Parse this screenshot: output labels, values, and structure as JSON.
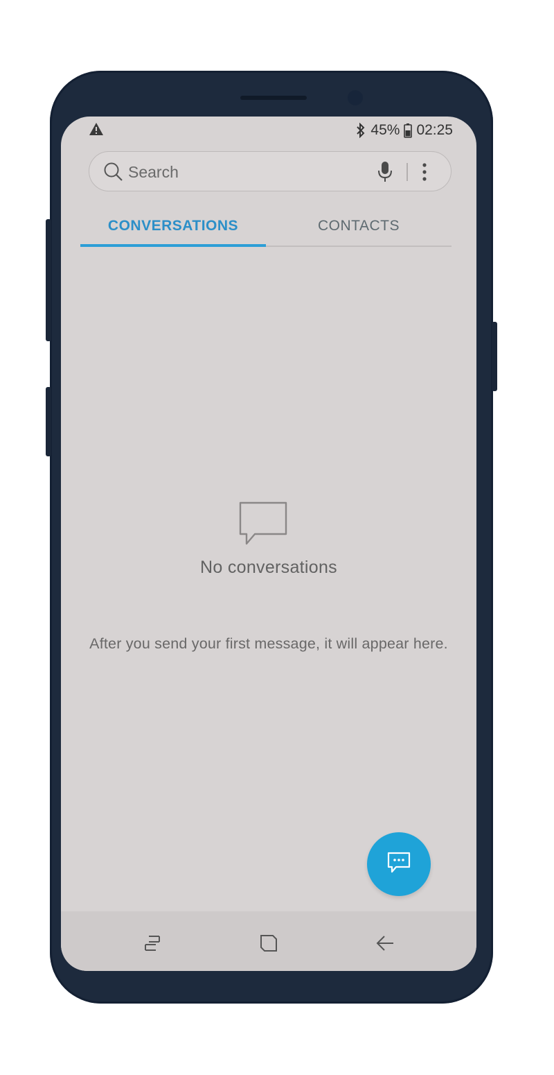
{
  "status_bar": {
    "battery": "45%",
    "time": "02:25"
  },
  "search": {
    "placeholder": "Search"
  },
  "tabs": [
    {
      "label": "CONVERSATIONS",
      "selected": true
    },
    {
      "label": "CONTACTS",
      "selected": false
    }
  ],
  "empty_state": {
    "title": "No conversations",
    "description": "After you send your first message, it will appear here."
  },
  "colors": {
    "accent": "#2c9ed6",
    "fab": "#1fa3d8",
    "screen_bg": "#d7d3d3",
    "phone_body": "#1d2a3d"
  },
  "icons": {
    "status_left": "warning-icon",
    "status_right": [
      "bluetooth-icon",
      "battery-icon"
    ],
    "search": [
      "search-icon",
      "microphone-icon",
      "more-options-icon"
    ],
    "empty_state": "speech-bubble-icon",
    "fab": "compose-message-icon",
    "nav": [
      "recent-apps-icon",
      "home-icon",
      "back-icon"
    ]
  }
}
